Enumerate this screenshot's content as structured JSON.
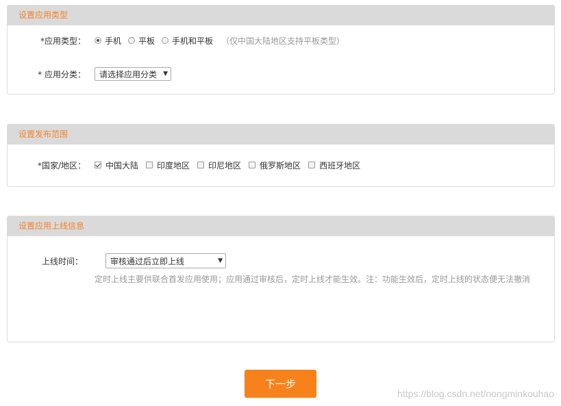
{
  "app_type_section": {
    "title": "设置应用类型",
    "app_type_label": "*应用类型：",
    "options": [
      {
        "label": "手机",
        "checked": true
      },
      {
        "label": "平板",
        "checked": false
      },
      {
        "label": "手机和平板",
        "checked": false
      }
    ],
    "note": "（仅中国大陆地区支持平板类型）",
    "category_label": "* 应用分类：",
    "category_select": "请选择应用分类"
  },
  "release_section": {
    "title": "设置发布范围",
    "region_label": "*国家/地区：",
    "regions": [
      {
        "label": "中国大陆",
        "checked": true
      },
      {
        "label": "印度地区",
        "checked": false
      },
      {
        "label": "印尼地区",
        "checked": false
      },
      {
        "label": "俄罗斯地区",
        "checked": false
      },
      {
        "label": "西班牙地区",
        "checked": false
      }
    ]
  },
  "online_section": {
    "title": "设置应用上线信息",
    "time_label": "上线时间：",
    "time_select": "审核通过后立即上线",
    "hint": "定时上线主要供联合首发应用使用；应用通过审核后，定时上线才能生效。注：功能生效后，定时上线的状态便无法撤消"
  },
  "next_button": "下一步",
  "watermark": "https://blog.csdn.net/nongminkouhao",
  "colors": {
    "accent": "#f7821b",
    "header_bg": "#dadada",
    "header_text": "#f7822b"
  }
}
